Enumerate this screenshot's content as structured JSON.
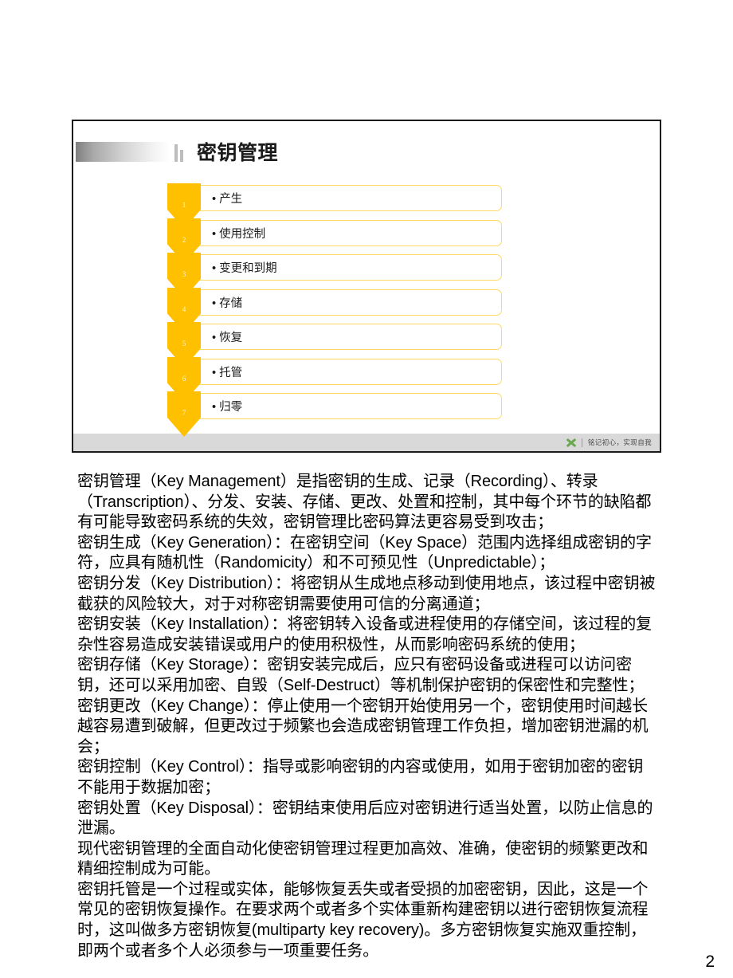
{
  "slide": {
    "title": "密钥管理",
    "steps": [
      {
        "num": "1",
        "label": "产生"
      },
      {
        "num": "2",
        "label": "使用控制"
      },
      {
        "num": "3",
        "label": "变更和到期"
      },
      {
        "num": "4",
        "label": "存储"
      },
      {
        "num": "5",
        "label": "恢复"
      },
      {
        "num": "6",
        "label": "托管"
      },
      {
        "num": "7",
        "label": "归零"
      }
    ],
    "footer": {
      "logo": "green-x-logo-icon",
      "text": "铭记初心，实现自我"
    },
    "colors": {
      "chevron": "#FFC000",
      "box_border": "#FFD966",
      "footer_bar": "#D9D9D9",
      "frame": "#1B1B1B"
    }
  },
  "body": {
    "paragraphs": [
      "密钥管理（Key Management）是指密钥的生成、记录（Recording）、转录（Transcription）、分发、安装、存储、更改、处置和控制，其中每个环节的缺陷都有可能导致密码系统的失效，密钥管理比密码算法更容易受到攻击；",
      "密钥生成（Key Generation）：在密钥空间（Key Space）范围内选择组成密钥的字符，应具有随机性（Randomicity）和不可预见性（Unpredictable）；",
      "密钥分发（Key Distribution）：将密钥从生成地点移动到使用地点，该过程中密钥被截获的风险较大，对于对称密钥需要使用可信的分离通道；",
      "密钥安装（Key Installation）：将密钥转入设备或进程使用的存储空间，该过程的复杂性容易造成安装错误或用户的使用积极性，从而影响密码系统的使用；",
      "密钥存储（Key Storage）：密钥安装完成后，应只有密码设备或进程可以访问密钥，还可以采用加密、自毁（Self-Destruct）等机制保护密钥的保密性和完整性；",
      "密钥更改（Key Change）：停止使用一个密钥开始使用另一个，密钥使用时间越长越容易遭到破解，但更改过于频繁也会造成密钥管理工作负担，增加密钥泄漏的机会；",
      "密钥控制（Key Control）：指导或影响密钥的内容或使用，如用于密钥加密的密钥不能用于数据加密；",
      "密钥处置（Key Disposal）：密钥结束使用后应对密钥进行适当处置，以防止信息的泄漏。",
      "现代密钥管理的全面自动化使密钥管理过程更加高效、准确，使密钥的频繁更改和精细控制成为可能。",
      "密钥托管是一个过程或实体，能够恢复丢失或者受损的加密密钥，因此，这是一个常见的密钥恢复操作。在要求两个或者多个实体重新构建密钥以进行密钥恢复流程时，这叫做多方密钥恢复(multiparty key recovery)。多方密钥恢复实施双重控制，即两个或者多个人必须参与一项重要任务。"
    ]
  },
  "page_number": "2"
}
